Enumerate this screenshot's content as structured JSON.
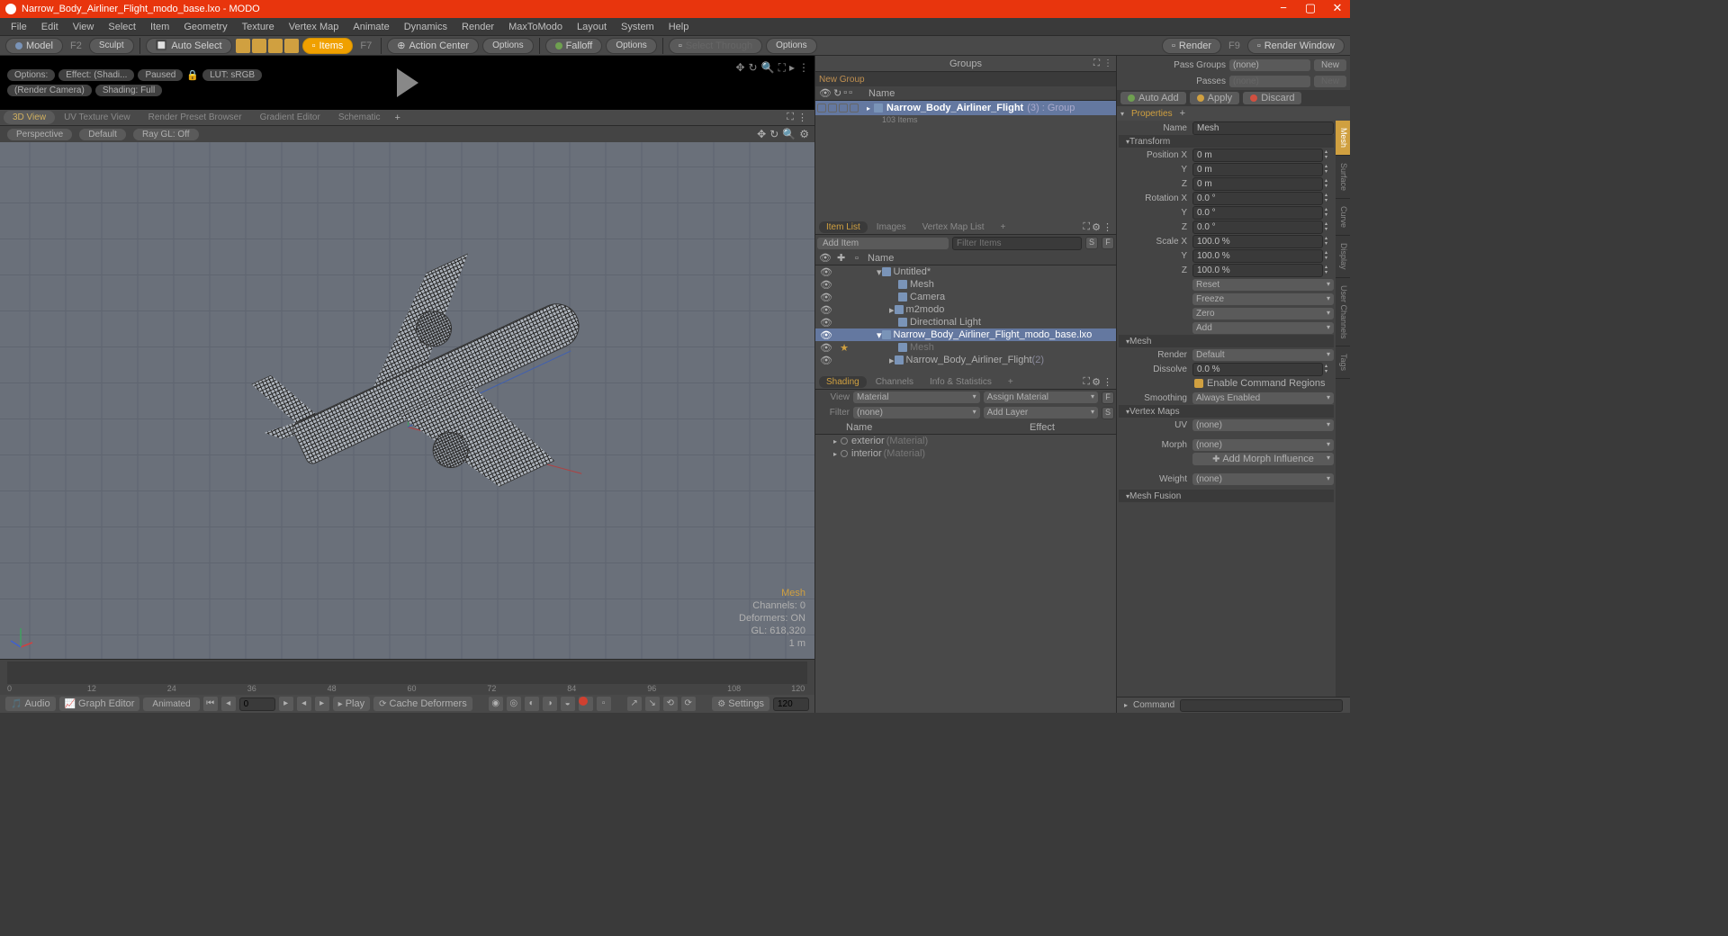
{
  "titlebar": {
    "text": "Narrow_Body_Airliner_Flight_modo_base.lxo - MODO"
  },
  "menubar": [
    "File",
    "Edit",
    "View",
    "Select",
    "Item",
    "Geometry",
    "Texture",
    "Vertex Map",
    "Animate",
    "Dynamics",
    "Render",
    "MaxToModo",
    "Layout",
    "System",
    "Help"
  ],
  "toolbar": {
    "model": "Model",
    "model_key": "F2",
    "sculpt": "Sculpt",
    "auto_select": "Auto Select",
    "items": "Items",
    "items_key": "F7",
    "action_center": "Action Center",
    "options1": "Options",
    "falloff": "Falloff",
    "options2": "Options",
    "select_through": "Select Through",
    "options3": "Options",
    "render": "Render",
    "render_key": "F9",
    "render_window": "Render Window"
  },
  "preview": {
    "options": "Options:",
    "effect": "Effect: (Shadi...",
    "paused": "Paused",
    "lock": "🔒",
    "lut": "LUT: sRGB",
    "camera": "(Render Camera)",
    "shading": "Shading: Full"
  },
  "viewport": {
    "tabs": [
      "3D View",
      "UV Texture View",
      "Render Preset Browser",
      "Gradient Editor",
      "Schematic"
    ],
    "sub": {
      "perspective": "Perspective",
      "default": "Default",
      "raygl": "Ray GL: Off"
    },
    "info": {
      "mesh": "Mesh",
      "channels": "Channels: 0",
      "deformers": "Deformers: ON",
      "gl": "GL: 618,320",
      "scale": "1 m"
    }
  },
  "groups": {
    "title": "Groups",
    "new_group": "New Group",
    "name_col": "Name",
    "item": {
      "name": "Narrow_Body_Airliner_Flight",
      "suffix": "(3) : Group",
      "sub": "103 Items"
    }
  },
  "item_list": {
    "tabs": [
      "Item List",
      "Images",
      "Vertex Map List"
    ],
    "add_item": "Add Item",
    "filter": "Filter Items",
    "name_col": "Name",
    "items": [
      {
        "name": "Untitled*",
        "indent": 0,
        "type": "scene",
        "arrow": "▾"
      },
      {
        "name": "Mesh",
        "indent": 1,
        "type": "mesh"
      },
      {
        "name": "Camera",
        "indent": 1,
        "type": "camera"
      },
      {
        "name": "m2modo",
        "indent": 1,
        "type": "group",
        "arrow": "▸"
      },
      {
        "name": "Directional Light",
        "indent": 1,
        "type": "light"
      },
      {
        "name": "Narrow_Body_Airliner_Flight_modo_base.lxo",
        "indent": 0,
        "type": "scene",
        "arrow": "▾",
        "sel": true
      },
      {
        "name": "Mesh",
        "indent": 1,
        "type": "mesh",
        "star": true,
        "dim": true
      },
      {
        "name": "Narrow_Body_Airliner_Flight",
        "indent": 1,
        "type": "group",
        "suffix": "(2)",
        "arrow": "▸"
      }
    ]
  },
  "shading": {
    "tabs": [
      "Shading",
      "Channels",
      "Info & Statistics"
    ],
    "view": "View",
    "material": "Material",
    "assign": "Assign Material",
    "filter": "Filter",
    "filter_val": "(none)",
    "add_layer": "Add Layer",
    "name_col": "Name",
    "effect_col": "Effect",
    "items": [
      {
        "name": "exterior",
        "type": "(Material)"
      },
      {
        "name": "interior",
        "type": "(Material)"
      }
    ]
  },
  "props": {
    "pass_groups": "Pass Groups",
    "pass_groups_val": "(none)",
    "new": "New",
    "passes": "Passes",
    "passes_val": "(none)",
    "new2": "New",
    "auto_add": "Auto Add",
    "apply": "Apply",
    "discard": "Discard",
    "properties": "Properties",
    "name": "Name",
    "name_val": "Mesh",
    "side_tabs": [
      "Mesh",
      "Surface",
      "Curve",
      "Display",
      "User Channels",
      "Tags"
    ],
    "transform": "Transform",
    "position": "Position X",
    "px": "0 m",
    "py": "0 m",
    "pz": "0 m",
    "rotation": "Rotation X",
    "rx": "0.0 °",
    "ry": "0.0 °",
    "rz": "0.0 °",
    "scale": "Scale X",
    "sx": "100.0 %",
    "sy": "100.0 %",
    "sz": "100.0 %",
    "y": "Y",
    "z": "Z",
    "reset": "Reset",
    "freeze": "Freeze",
    "zero": "Zero",
    "add": "Add",
    "mesh_section": "Mesh",
    "render": "Render",
    "render_val": "Default",
    "dissolve": "Dissolve",
    "dissolve_val": "0.0 %",
    "cmd_regions": "Enable Command Regions",
    "smoothing": "Smoothing",
    "smoothing_val": "Always Enabled",
    "vertex_maps": "Vertex Maps",
    "uv": "UV",
    "uv_val": "(none)",
    "morph": "Morph",
    "morph_val": "(none)",
    "add_morph": "Add Morph Influence",
    "weight": "Weight",
    "weight_val": "(none)",
    "mesh_fusion": "Mesh Fusion"
  },
  "timeline": {
    "ticks": [
      0,
      12,
      24,
      36,
      48,
      60,
      72,
      84,
      96,
      108,
      120
    ],
    "start": "0",
    "end": "120",
    "audio": "Audio",
    "graph": "Graph Editor",
    "animated": "Animated",
    "play": "Play",
    "cache": "Cache Deformers",
    "settings": "Settings"
  },
  "command": "Command"
}
